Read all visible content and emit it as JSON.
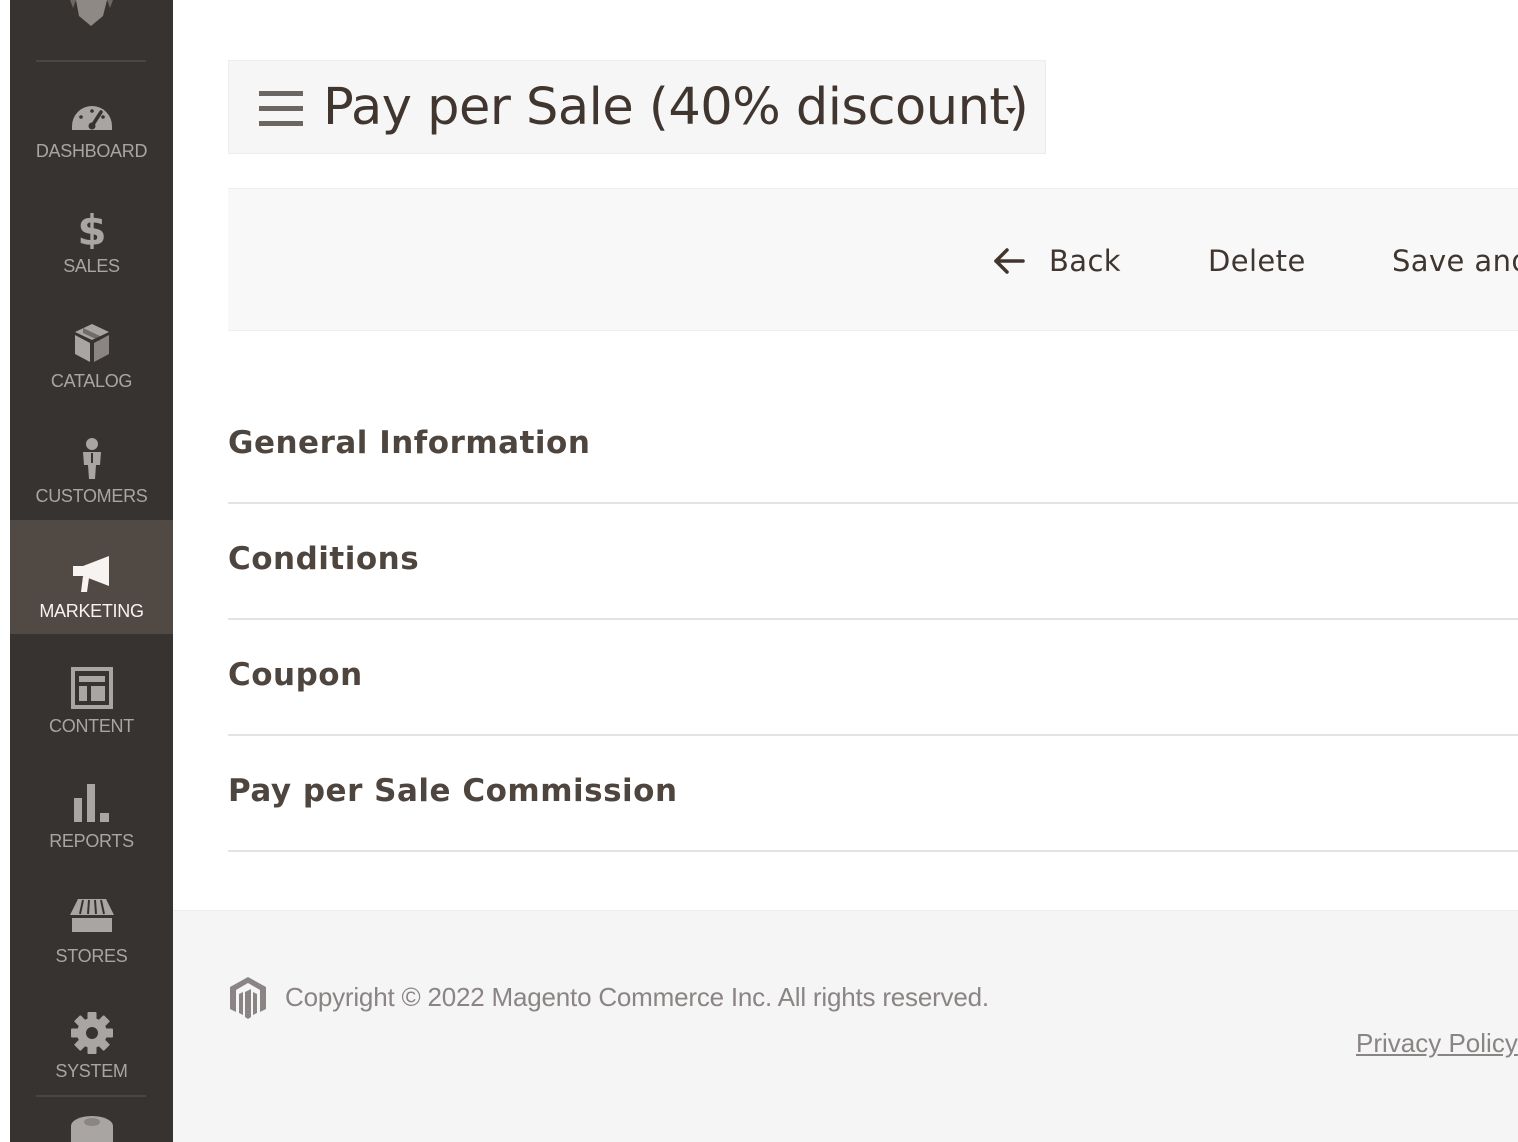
{
  "sidebar": {
    "items": [
      {
        "label": "DASHBOARD",
        "icon": "dashboard-icon"
      },
      {
        "label": "SALES",
        "icon": "dollar-icon"
      },
      {
        "label": "CATALOG",
        "icon": "box-icon"
      },
      {
        "label": "CUSTOMERS",
        "icon": "person-icon"
      },
      {
        "label": "MARKETING",
        "icon": "megaphone-icon",
        "active": true
      },
      {
        "label": "CONTENT",
        "icon": "layout-icon"
      },
      {
        "label": "REPORTS",
        "icon": "bar-chart-icon"
      },
      {
        "label": "STORES",
        "icon": "storefront-icon"
      },
      {
        "label": "SYSTEM",
        "icon": "gear-icon"
      }
    ],
    "colors": {
      "background": "#373330",
      "active_background": "#514943",
      "icon": "#a9a5a2",
      "active_icon": "#f7f3f0"
    }
  },
  "header": {
    "title": "Pay per Sale (40% discount)"
  },
  "actions": {
    "back_label": "Back",
    "delete_label": "Delete",
    "save_label": "Save and"
  },
  "sections": [
    {
      "title": "General Information"
    },
    {
      "title": "Conditions"
    },
    {
      "title": "Coupon"
    },
    {
      "title": "Pay per Sale Commission"
    }
  ],
  "footer": {
    "copyright": "Copyright © 2022 Magento Commerce Inc. All rights reserved.",
    "privacy_label": "Privacy Policy"
  }
}
